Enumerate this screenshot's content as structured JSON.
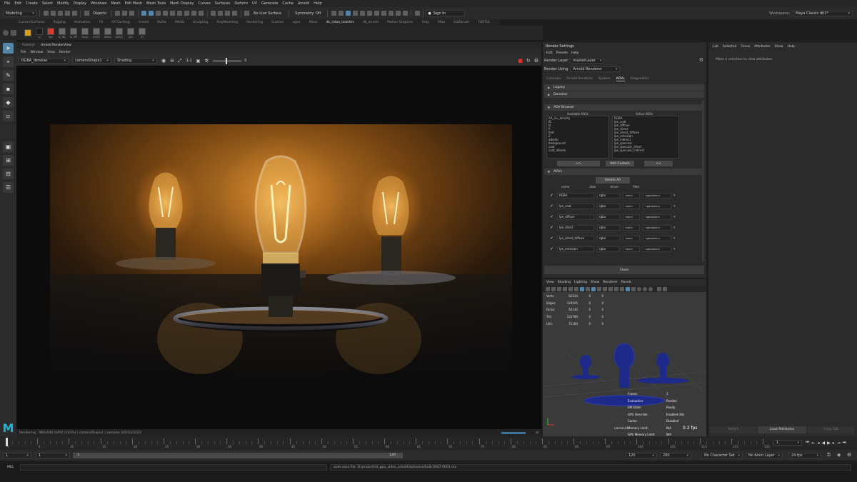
{
  "menubar": {
    "items": [
      "File",
      "Edit",
      "Create",
      "Select",
      "Modify",
      "Display",
      "Windows",
      "Mesh",
      "Edit Mesh",
      "Mesh Tools",
      "Mesh Display",
      "Curves",
      "Surfaces",
      "Deform",
      "UV",
      "Generate",
      "Cache",
      "Arnold",
      "Help"
    ],
    "workspace_label": "Workspace:",
    "workspace_value": "Maya Classic dit1*"
  },
  "statusline": {
    "mode": "Modeling",
    "objects_label": "Objects",
    "live_surface": "No Live Surface",
    "symmetry": "Symmetry: Off",
    "sign_in": "Sign In"
  },
  "shelf_tabs": [
    "Curves/Surfaces",
    "Rigging",
    "Animation",
    "FX",
    "FX Caching",
    "Arnold",
    "Bullet",
    "MASH",
    "Sculpting",
    "PolyModeling",
    "Rendering",
    "Custom",
    "xgen",
    "XGen",
    "dk_mtoa_lookdev",
    "dk_arnold",
    "Motion Graphics",
    "Vray",
    "Ktoa",
    "GoZbrush",
    "TURTLE"
  ],
  "shelf_active_tab": "dk_mtoa_lookdev",
  "shelf_left_tabs": [
    "Custom",
    "Selection"
  ],
  "shelf_items": [
    "",
    "ai",
    "dof",
    "ai_IBL",
    "ai_IPR",
    "Arcpr",
    "aiSSS",
    "aiSkin",
    "aiMLS",
    "Aflr",
    "Ki"
  ],
  "render_view": {
    "tabs": [
      "Outliner",
      "Arnold RenderView"
    ],
    "menu": [
      "File",
      "Window",
      "View",
      "Render"
    ],
    "aov_dropdown": "RGBA_denoise",
    "camera_dropdown": "cameraShape1",
    "shading_dropdown": "Shading",
    "ratio": "1:1",
    "exposure": "0",
    "status": "Rendering : 960x540 (GPU) (141%) | cameraShape1 | samples 3/2/2/2/2/2/2"
  },
  "render_settings": {
    "title": "Render Settings",
    "menu": [
      "Edit",
      "Presets",
      "Help"
    ],
    "layer_label": "Render Layer",
    "layer_value": "masterLayer",
    "using_label": "Render Using",
    "using_value": "Arnold Renderer",
    "tabs": [
      "Common",
      "Arnold Renderer",
      "System",
      "AOVs",
      "Diagnostics"
    ],
    "active_tab": "AOVs",
    "sections": [
      "Legacy",
      "Denoiser",
      "AOV Browser",
      "AOVs"
    ],
    "available_label": "Available AOVs",
    "active_label": "Active AOVs",
    "available": [
      "AA_inv_density",
      "ID",
      "N",
      "P",
      "Pref",
      "Z",
      "albedo",
      "background",
      "coat",
      "coat_albedo"
    ],
    "active": [
      "RGBA",
      "lpe_coat",
      "lpe_diffuse",
      "lpe_direct",
      "lpe_direct_diffuse",
      "lpe_emission",
      "lpe_indirect",
      "lpe_specular",
      "lpe_specular_direct",
      "lpe_specular_indirect"
    ],
    "move_right": ">>",
    "add_custom": "Add Custom",
    "move_left": "<<",
    "delete_all": "Delete All",
    "columns": [
      "name",
      "data",
      "driver",
      "filter"
    ],
    "rows": [
      {
        "name": "RGBA",
        "data": "rgba",
        "driver": "<exr>",
        "filter": "<gaussian>"
      },
      {
        "name": "lpe_coat",
        "data": "rgba",
        "driver": "<exr>",
        "filter": "<gaussian>"
      },
      {
        "name": "lpe_diffuse",
        "data": "rgba",
        "driver": "<exr>",
        "filter": "<gaussian>"
      },
      {
        "name": "lpe_direct",
        "data": "rgba",
        "driver": "<exr>",
        "filter": "<gaussian>"
      },
      {
        "name": "lpe_direct_diffuse",
        "data": "rgba",
        "driver": "<exr>",
        "filter": "<gaussian>"
      },
      {
        "name": "lpe_emission",
        "data": "rgba",
        "driver": "<exr>",
        "filter": "<gaussian>"
      }
    ],
    "close": "Close"
  },
  "attribute_editor": {
    "menu": [
      "List",
      "Selected",
      "Focus",
      "Attributes",
      "Show",
      "Help"
    ],
    "message": "Make a selection to view attributes.",
    "buttons": [
      "Select",
      "Load Attributes",
      "Copy Tab"
    ]
  },
  "viewport": {
    "menu": [
      "View",
      "Shading",
      "Lighting",
      "Show",
      "Renderer",
      "Panels"
    ],
    "stats": [
      {
        "label": "Verts:",
        "v": "62334",
        "a": "0",
        "b": "0"
      },
      {
        "label": "Edges:",
        "v": "124505",
        "a": "0",
        "b": "0"
      },
      {
        "label": "Faces:",
        "v": "62142",
        "a": "0",
        "b": "0"
      },
      {
        "label": "Tris:",
        "v": "123780",
        "a": "0",
        "b": "0"
      },
      {
        "label": "UVs:",
        "v": "71184",
        "a": "0",
        "b": "0"
      }
    ],
    "hud": [
      {
        "label": "Frame:",
        "value": "1"
      },
      {
        "label": "Evaluation:",
        "value": "Parallel"
      },
      {
        "label": "EM State:",
        "value": "Ready"
      },
      {
        "label": "GPU Override:",
        "value": "Enabled (0k)"
      },
      {
        "label": "Cache:",
        "value": "Disabled"
      },
      {
        "label": "Memory Limit:",
        "value": "N/A"
      },
      {
        "label": "GPU Memory Limit:",
        "value": "N/A"
      }
    ],
    "camera": "camera1",
    "fps": "0.2 fps"
  },
  "timeline": {
    "ticks": [
      "1",
      "5",
      "10",
      "15",
      "20",
      "25",
      "30",
      "35",
      "40",
      "45",
      "50",
      "55",
      "60",
      "65",
      "70",
      "75",
      "80",
      "85",
      "90",
      "95",
      "100",
      "105",
      "110",
      "115",
      "120"
    ],
    "current_frame": "1",
    "start": "1",
    "range_start": "1",
    "range_end": "120",
    "end_a": "120",
    "end_b": "200",
    "char_set": "No Character Set",
    "anim_layer": "No Anim Layer",
    "fps": "24 fps",
    "frame_field": "1"
  },
  "command": {
    "label": "MEL",
    "message": "auto-save file: D:/project/sd_gpu_video_arnold/autosave/bulb.0007.0001.ma"
  },
  "colors": {
    "accent": "#5285a6",
    "panel": "#2b2b2b",
    "glow": "#e6a04a",
    "wire": "#1d2a8a"
  }
}
